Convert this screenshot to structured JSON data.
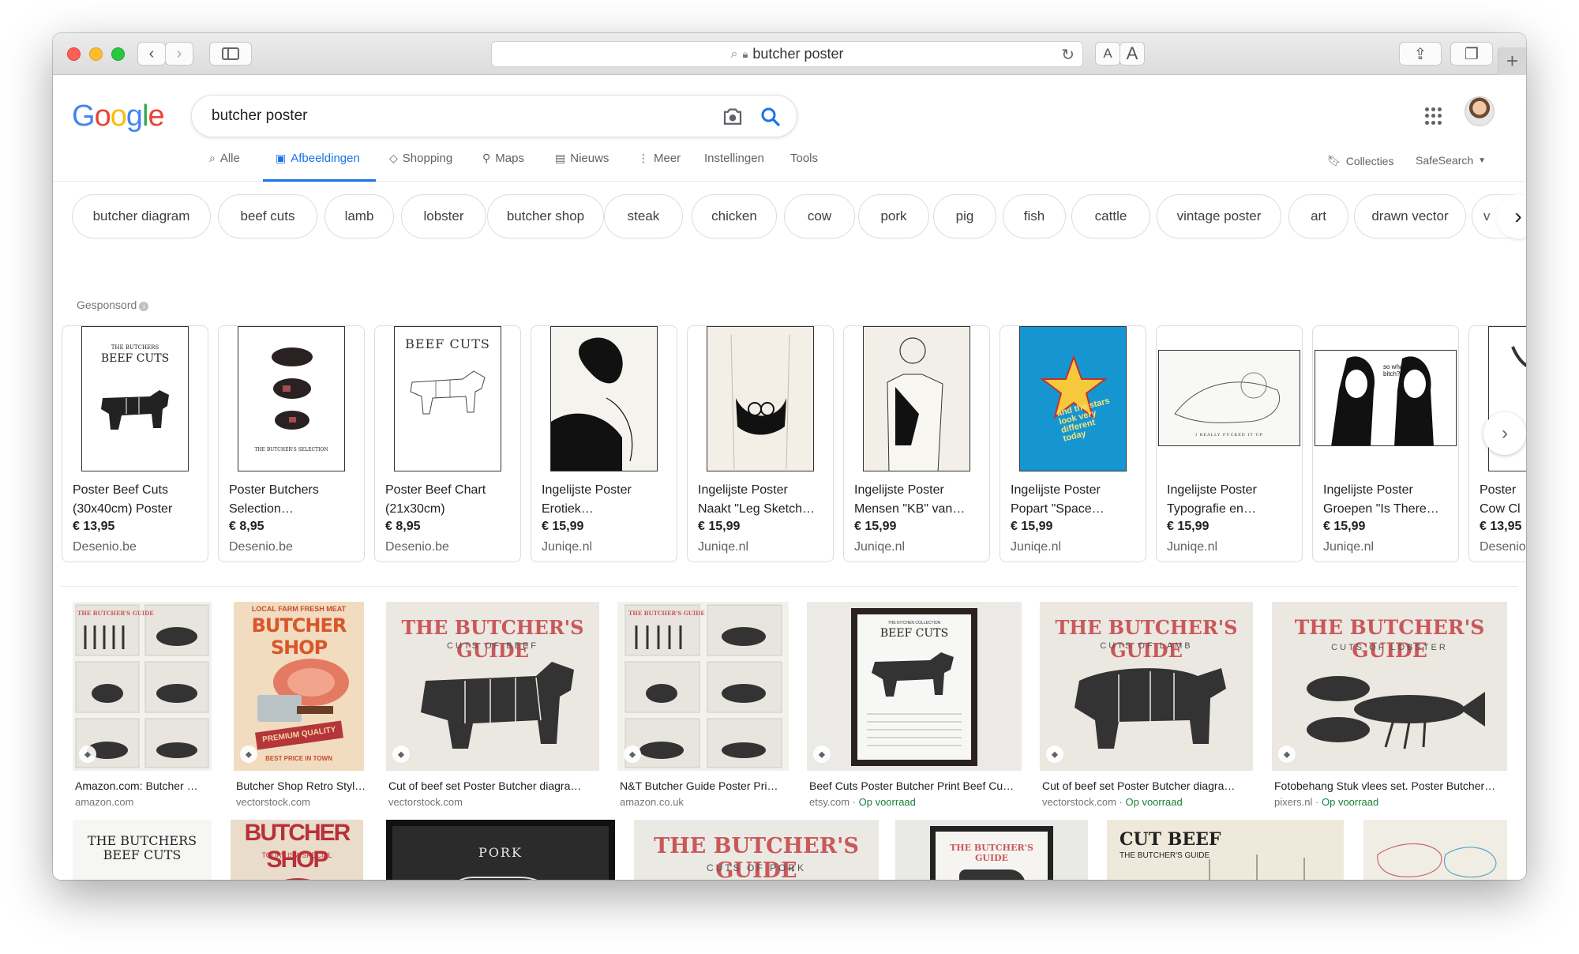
{
  "browser": {
    "url": "butcher poster",
    "font_small": "A",
    "font_large": "A"
  },
  "google": {
    "logo": [
      "G",
      "o",
      "o",
      "g",
      "l",
      "e"
    ],
    "logo_colors": [
      "#4285F4",
      "#EA4335",
      "#FBBC05",
      "#4285F4",
      "#34A853",
      "#EA4335"
    ],
    "query": "butcher poster",
    "nav": [
      {
        "label": "Alle",
        "icon": "search-icon"
      },
      {
        "label": "Afbeeldingen",
        "icon": "image-icon",
        "active": true
      },
      {
        "label": "Shopping",
        "icon": "tag-icon"
      },
      {
        "label": "Maps",
        "icon": "pin-icon"
      },
      {
        "label": "Nieuws",
        "icon": "news-icon"
      },
      {
        "label": "Meer",
        "icon": "more-icon"
      },
      {
        "label": "Instellingen"
      },
      {
        "label": "Tools"
      }
    ],
    "collections": "Collecties",
    "safesearch": "SafeSearch",
    "accent": "#1a73e8"
  },
  "chips": [
    "butcher diagram",
    "beef cuts",
    "lamb",
    "lobster",
    "butcher shop",
    "steak",
    "chicken",
    "cow",
    "pork",
    "pig",
    "fish",
    "cattle",
    "vintage poster",
    "art",
    "drawn vector",
    "v"
  ],
  "sponsored": "Gesponsord",
  "products": [
    {
      "title1": "Poster Beef Cuts",
      "title2": "(30x40cm) Poster",
      "price": "€ 13,95",
      "shop": "Desenio.be",
      "poster_text": "THE BUTCHERS\nBEEF CUTS"
    },
    {
      "title1": "Poster Butchers",
      "title2": "Selection…",
      "price": "€ 8,95",
      "shop": "Desenio.be",
      "poster_text": "THE BUTCHER'S\nSELECTION"
    },
    {
      "title1": "Poster Beef Chart",
      "title2": "(21x30cm)",
      "price": "€ 8,95",
      "shop": "Desenio.be",
      "poster_text": "BEEF CUTS"
    },
    {
      "title1": "Ingelijste Poster",
      "title2": "Erotiek…",
      "price": "€ 15,99",
      "shop": "Juniqe.nl",
      "poster_text": ""
    },
    {
      "title1": "Ingelijste Poster",
      "title2": "Naakt \"Leg Sketch…",
      "price": "€ 15,99",
      "shop": "Juniqe.nl",
      "poster_text": ""
    },
    {
      "title1": "Ingelijste Poster",
      "title2": "Mensen \"KB\" van…",
      "price": "€ 15,99",
      "shop": "Juniqe.nl",
      "poster_text": ""
    },
    {
      "title1": "Ingelijste Poster",
      "title2": "Popart \"Space…",
      "price": "€ 15,99",
      "shop": "Juniqe.nl",
      "poster_text": "and the stars look very different today"
    },
    {
      "title1": "Ingelijste Poster",
      "title2": "Typografie en…",
      "price": "€ 15,99",
      "shop": "Juniqe.nl",
      "poster_text": "I REALLY FUCKED IT UP"
    },
    {
      "title1": "Ingelijste Poster",
      "title2": "Groepen \"Is There…",
      "price": "€ 15,99",
      "shop": "Juniqe.nl",
      "poster_text": "so what, bitch?"
    },
    {
      "title1": "Poster",
      "title2": "Cow Cl",
      "price": "€ 13,95",
      "shop": "Desenio",
      "poster_text": ""
    }
  ],
  "results": [
    {
      "title": "Amazon.com: Butcher …",
      "source": "amazon.com",
      "stock": "",
      "poster_title": "THE BUTCHER'S GUIDE",
      "poster_sub": ""
    },
    {
      "title": "Butcher Shop Retro Styl…",
      "source": "vectorstock.com",
      "stock": "",
      "poster_title": "BUTCHER SHOP",
      "poster_sub": "LOCAL FARM FRESH MEAT",
      "poster_badge": "PREMIUM QUALITY",
      "poster_foot": "BEST PRICE IN TOWN"
    },
    {
      "title": "Cut of beef set Poster Butcher diagra…",
      "source": "vectorstock.com",
      "stock": "",
      "poster_title": "THE BUTCHER'S GUIDE",
      "poster_sub": "CUTS OF BEEF"
    },
    {
      "title": "N&T Butcher Guide Poster Pri…",
      "source": "amazon.co.uk",
      "stock": "",
      "poster_title": "THE BUTCHER'S GUIDE",
      "poster_sub": ""
    },
    {
      "title": "Beef Cuts Poster Butcher Print Beef Cu…",
      "source": "etsy.com",
      "stock": "Op voorraad",
      "poster_title": "BEEF CUTS",
      "poster_sub": "THE KITCHEN COLLECTION"
    },
    {
      "title": "Cut of beef set Poster Butcher diagra…",
      "source": "vectorstock.com",
      "stock": "Op voorraad",
      "poster_title": "THE BUTCHER'S GUIDE",
      "poster_sub": "CUTS OF LAMB"
    },
    {
      "title": "Fotobehang Stuk vlees set. Poster Butcher…",
      "source": "pixers.nl",
      "stock": "Op voorraad",
      "poster_title": "THE BUTCHER'S GUIDE",
      "poster_sub": "CUTS OF LOBSTER"
    }
  ],
  "row3": [
    {
      "poster_title": "THE BUTCHERS\nBEEF CUTS"
    },
    {
      "poster_title": "BUTCHER SHOP",
      "poster_sub": "TODAY IS A SPECIAL"
    },
    {
      "poster_title": "PORK"
    },
    {
      "poster_title": "THE BUTCHER'S GUIDE",
      "poster_sub": "CUTS OF PORK"
    },
    {
      "poster_title": "THE BUTCHER'S GUIDE"
    },
    {
      "poster_title": "CUT BEEF",
      "poster_sub": "THE BUTCHER'S GUIDE"
    },
    {
      "poster_title": ""
    }
  ]
}
